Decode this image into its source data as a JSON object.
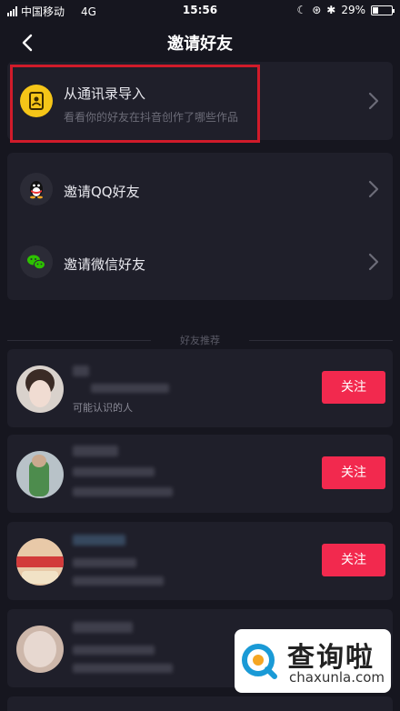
{
  "status_bar": {
    "carrier": "中国移动",
    "network": "4G",
    "time": "15:56",
    "battery": "29%",
    "battery_level": 0.29
  },
  "header": {
    "title": "邀请好友"
  },
  "contacts_import": {
    "title": "从通讯录导入",
    "subtitle": "看看你的好友在抖音创作了哪些作品"
  },
  "invite_options": [
    {
      "label": "邀请QQ好友",
      "icon": "qq-penguin-icon"
    },
    {
      "label": "邀请微信好友",
      "icon": "wechat-icon"
    }
  ],
  "recommendations": {
    "section_label": "好友推荐",
    "items": [
      {
        "subtitle": "可能认识的人",
        "button": "关注"
      },
      {
        "subtitle": "",
        "button": "关注"
      },
      {
        "subtitle": "",
        "button": "关注"
      },
      {
        "subtitle": "",
        "button": ""
      }
    ]
  },
  "watermark": {
    "cn": "查询啦",
    "en": "chaxunla.com"
  },
  "colors": {
    "background": "#16161f",
    "card": "#1f1f2a",
    "accent": "#f2294e",
    "highlight_border": "#d01b2a",
    "contacts_icon": "#f5c518",
    "wechat": "#2dc100"
  }
}
